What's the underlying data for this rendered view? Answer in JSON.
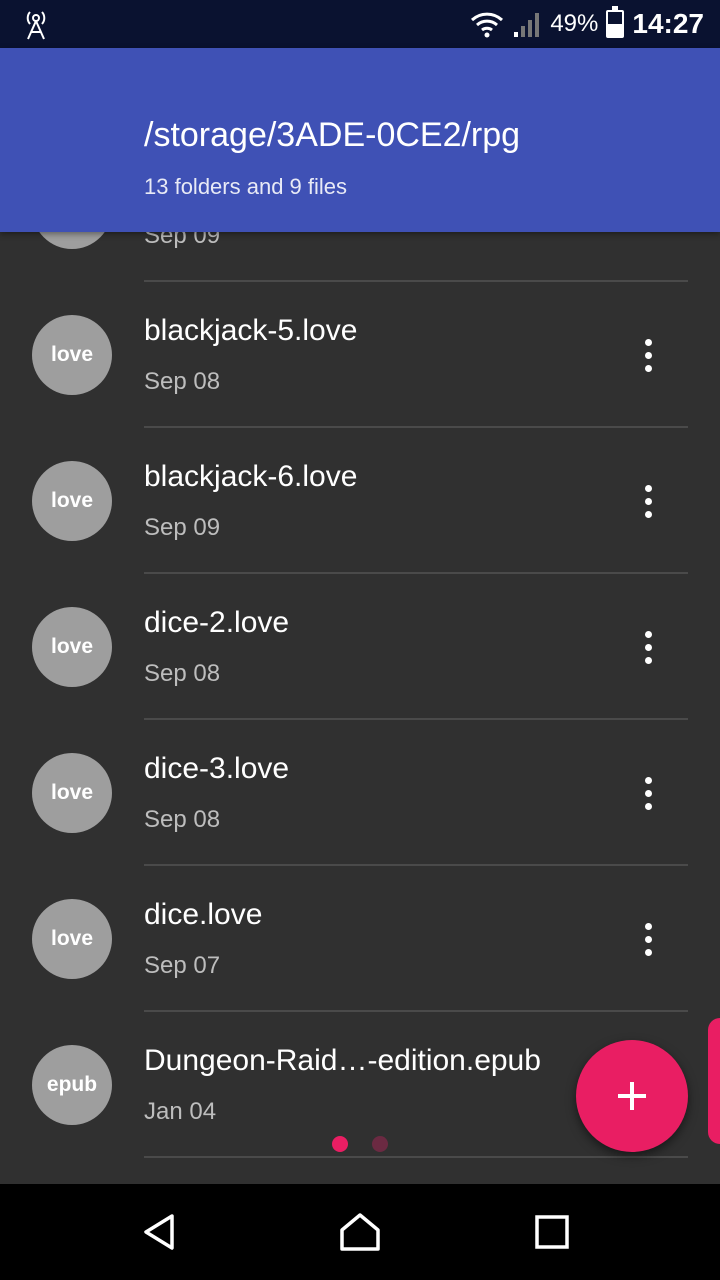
{
  "status_bar": {
    "battery_percent": "49%",
    "battery_level": 0.49,
    "time": "14:27",
    "icons": [
      "antenna-icon",
      "wifi-icon",
      "signal-icon",
      "battery-icon"
    ]
  },
  "header": {
    "path": "/storage/3ADE-0CE2/rpg",
    "subtitle": "13 folders and 9 files",
    "color": "#3f51b5"
  },
  "partial_row": {
    "date": "Sep 09"
  },
  "files": [
    {
      "badge": "love",
      "name": "blackjack-5.love",
      "date": "Sep 08"
    },
    {
      "badge": "love",
      "name": "blackjack-6.love",
      "date": "Sep 09"
    },
    {
      "badge": "love",
      "name": "dice-2.love",
      "date": "Sep 08"
    },
    {
      "badge": "love",
      "name": "dice-3.love",
      "date": "Sep 08"
    },
    {
      "badge": "love",
      "name": "dice.love",
      "date": "Sep 07"
    },
    {
      "badge": "epub",
      "name": "Dungeon-Raid…-edition.epub",
      "date": "Jan 04"
    }
  ],
  "fab": {
    "icon": "plus-icon",
    "color": "#e91e63"
  },
  "page_indicator": {
    "count": 2,
    "active": 0
  },
  "nav": {
    "back": "back-icon",
    "home": "home-icon",
    "recents": "recents-icon"
  }
}
